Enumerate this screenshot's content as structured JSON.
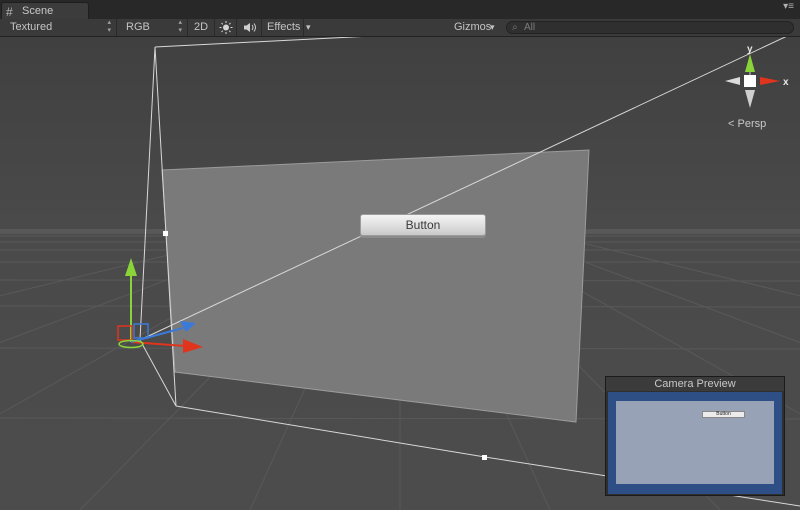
{
  "tab": {
    "icon": "scene-grid-icon",
    "title": "Scene"
  },
  "panel_menu_icon": "panel-menu-icon",
  "toolbar": {
    "draw_mode": "Textured",
    "render_mode": "RGB",
    "mode_2d": "2D",
    "lighting_icon": "sun-icon",
    "audio_icon": "speaker-icon",
    "effects": "Effects",
    "effects_arrow": "▾",
    "gizmos": "Gizmos",
    "gizmos_arrow": "▾",
    "search_icon": "search-icon",
    "search_placeholder": "All"
  },
  "scene": {
    "canvas_button_label": "Button",
    "orientation_gizmo": {
      "y_label": "y",
      "x_label": "x",
      "projection": "Persp"
    },
    "colors": {
      "background": "#464646",
      "canvas": "#7a7a7a",
      "x_axis": "#e0341c",
      "y_axis": "#8ad43a",
      "z_axis": "#3b7ad9"
    }
  },
  "camera_preview": {
    "title": "Camera Preview",
    "button_label": "Button",
    "colors": {
      "frame": "#2d4f86",
      "view": "#97a2b7"
    }
  }
}
